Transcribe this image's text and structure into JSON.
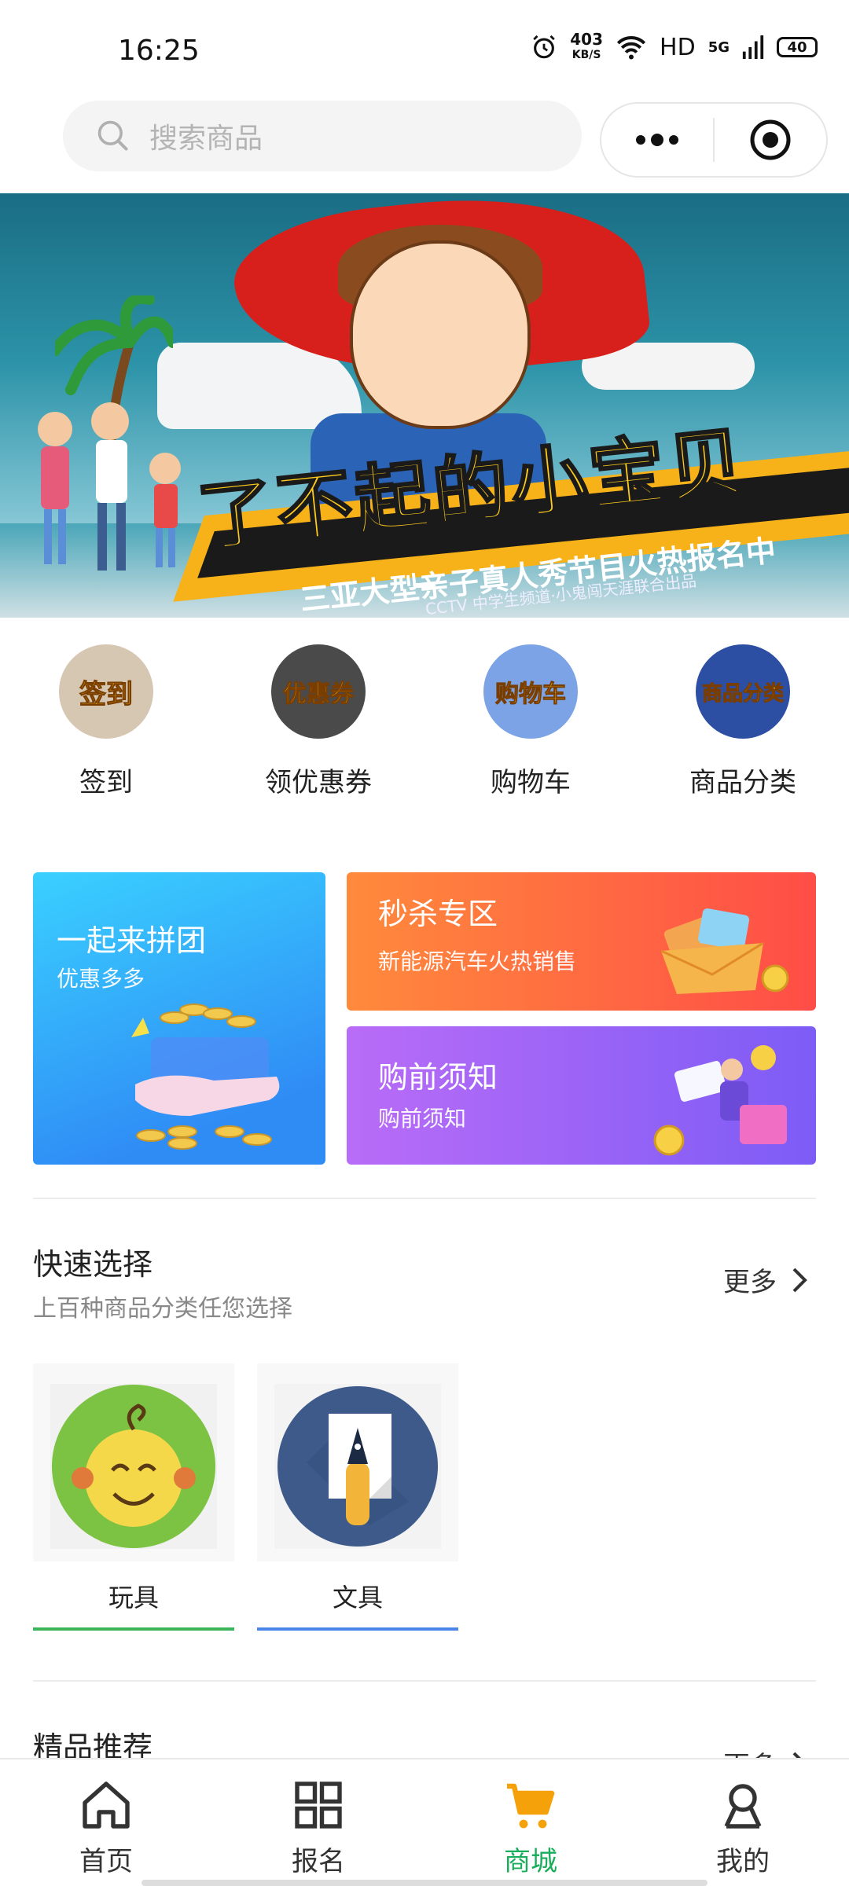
{
  "status_bar": {
    "time": "16:25",
    "speed_value": "403",
    "speed_unit": "KB/S",
    "network_hd": "HD",
    "network_5g": "5G",
    "battery": "40"
  },
  "top_bar": {
    "search_placeholder": "搜索商品",
    "more_icon": "more-dots-icon",
    "record_icon": "record-icon"
  },
  "banner": {
    "headline": "了不起的小宝贝",
    "subline": "三亚大型亲子真人秀节目火热报名中",
    "credit": "CCTV 中学生频道·小鬼闯天涯联合出品",
    "carousel_index": 1
  },
  "quick_nav": [
    {
      "label": "签到",
      "art_text": "签到",
      "color": "#d6c7b2"
    },
    {
      "label": "领优惠券",
      "art_text": "优惠券",
      "color": "#4a4a4a"
    },
    {
      "label": "购物车",
      "art_text": "购物车",
      "color": "#7ba3e6"
    },
    {
      "label": "商品分类",
      "art_text": "商品分类",
      "color": "#2c4fa3"
    }
  ],
  "promo_cards": {
    "group": {
      "title": "一起来拼团",
      "subtitle": "优惠多多"
    },
    "flash": {
      "title": "秒杀专区",
      "subtitle": "新能源汽车火热销售"
    },
    "notice": {
      "title": "购前须知",
      "subtitle": "购前须知"
    }
  },
  "quick_select": {
    "title": "快速选择",
    "subtitle": "上百种商品分类任您选择",
    "more": "更多",
    "items": [
      {
        "label": "玩具",
        "accent": "#3cb45a"
      },
      {
        "label": "文具",
        "accent": "#4a86e8"
      }
    ]
  },
  "featured": {
    "title": "精品推荐",
    "more": "更多"
  },
  "tabbar": [
    {
      "label": "首页",
      "icon": "home-icon",
      "active": false
    },
    {
      "label": "报名",
      "icon": "grid-icon",
      "active": false
    },
    {
      "label": "商城",
      "icon": "cart-icon",
      "active": true
    },
    {
      "label": "我的",
      "icon": "user-icon",
      "active": false
    }
  ],
  "colors": {
    "active_tab": "#1aad5b",
    "active_cart_icon": "#f5a20a"
  }
}
